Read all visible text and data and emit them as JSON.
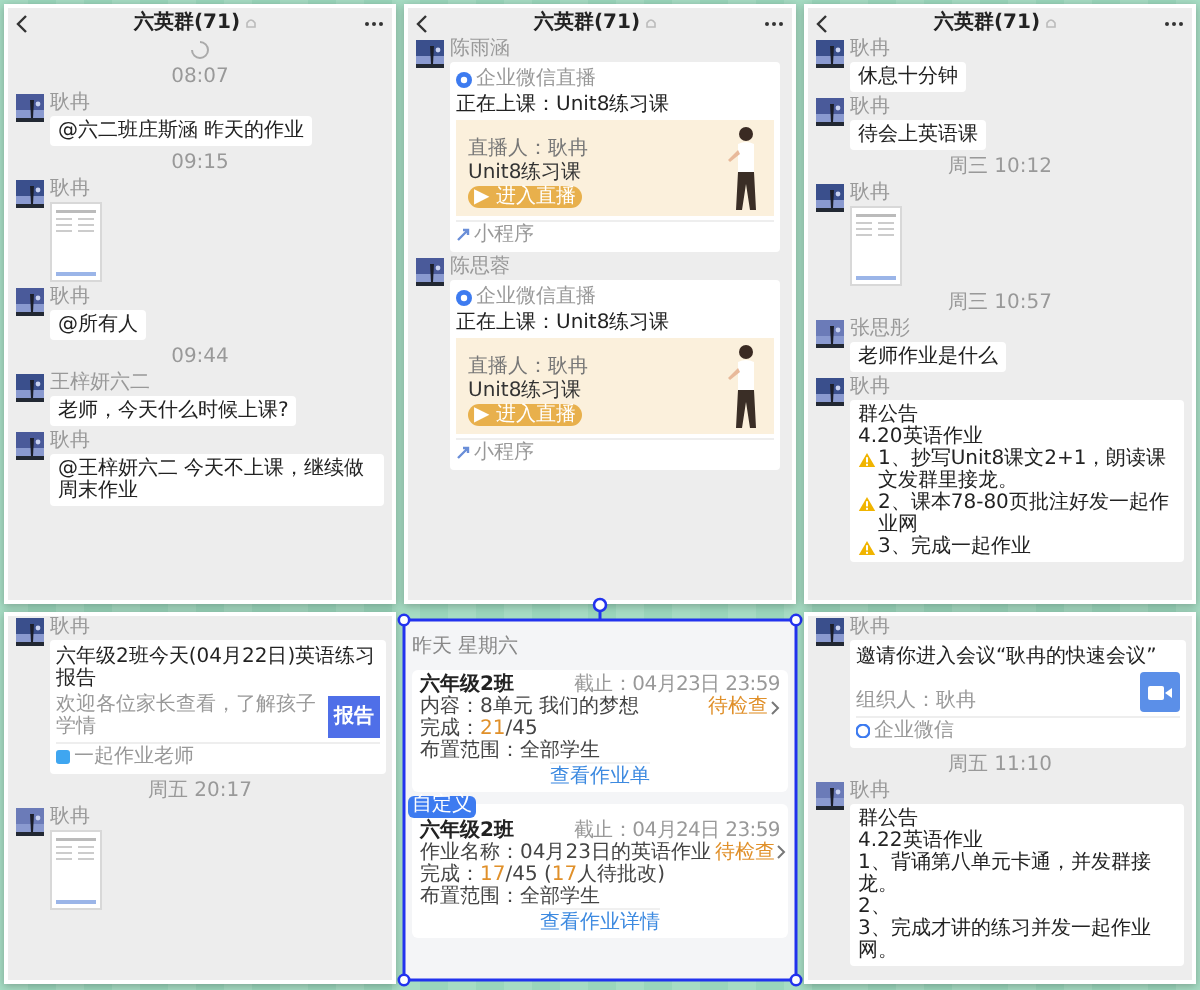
{
  "panels": [
    {
      "kind": "chat",
      "header": {
        "title": "六英群(71)"
      },
      "loading": true,
      "messages": [
        {
          "kind": "time",
          "text": "08:07"
        },
        {
          "kind": "text",
          "sender": "耿冉",
          "text": "@六二班庄斯涵  昨天的作业"
        },
        {
          "kind": "time",
          "text": "09:15"
        },
        {
          "sender": "耿冉"
        },
        {
          "kind": "text",
          "sender": "耿冉",
          "text": "@所有人"
        },
        {
          "kind": "time",
          "text": "09:44"
        },
        {
          "kind": "text",
          "sender": "王梓妍六二",
          "text": "老师，今天什么时候上课?"
        },
        {
          "kind": "text",
          "sender": "耿冉",
          "text": "@王梓妍六二  今天不上课，继续做周末作业"
        }
      ]
    },
    {
      "kind": "chat",
      "header": {
        "title": "六英群(71)"
      },
      "messages": [
        {
          "kind": "live",
          "sender": "陈雨涵",
          "app": "企业微信直播",
          "title": "正在上课：Unit8练习课",
          "host": "直播人：耿冉",
          "course": "Unit8练习课",
          "action": "▶ 进入直播",
          "footer": "小程序"
        },
        {
          "kind": "live",
          "sender": "陈思蓉",
          "app": "企业微信直播",
          "title": "正在上课：Unit8练习课",
          "host": "直播人：耿冉",
          "course": "Unit8练习课",
          "action": "▶ 进入直播",
          "footer": "小程序"
        }
      ]
    },
    {
      "kind": "chat",
      "header": {
        "title": "六英群(71)"
      },
      "messages": [
        {
          "kind": "text",
          "sender": "耿冉",
          "text": "休息十分钟"
        },
        {
          "kind": "text",
          "sender": "耿冉",
          "text": "待会上英语课"
        },
        {
          "kind": "time",
          "text": "周三 10:12"
        },
        {
          "sender": "耿冉"
        },
        {
          "kind": "time",
          "text": "周三 10:57"
        },
        {
          "kind": "text",
          "sender": "张思彤",
          "text": "老师作业是什么"
        },
        {
          "kind": "notice",
          "sender": "耿冉",
          "lines": [
            {
              "text": "群公告",
              "warn": false
            },
            {
              "text": "4.20英语作业",
              "warn": false
            },
            {
              "text": "1、抄写Unit8课文2+1，朗读课文发群里接龙。",
              "warn": true
            },
            {
              "text": "2、课本78-80页批注好发一起作业网",
              "warn": true
            },
            {
              "text": "3、完成一起作业",
              "warn": true
            }
          ]
        }
      ]
    },
    {
      "kind": "chat",
      "messages": [
        {
          "kind": "report",
          "sender": "耿冉",
          "title": "六年级2班今天(04月22日)英语练习报告",
          "desc": "欢迎各位家长查看，了解孩子学情",
          "badge": "报告",
          "footer": "一起作业老师"
        },
        {
          "kind": "time",
          "text": "周五 20:17"
        },
        {
          "sender": "耿冉"
        }
      ]
    },
    {
      "kind": "homework",
      "selected": true,
      "date": "昨天 星期六",
      "items": [
        {
          "class": "六年级2班",
          "deadline": "截止：04月23日 23:59",
          "detail": "内容：8单元 我们的梦想",
          "status": "待检查",
          "done": [
            {
              "text": "完成：",
              "highlight": false
            },
            {
              "text": "21",
              "highlight": true
            },
            {
              "text": "/45",
              "highlight": false
            }
          ],
          "scope": "布置范围：全部学生",
          "link": "查看作业单"
        },
        {
          "tag": "自定义",
          "class": "六年级2班",
          "deadline": "截止：04月24日 23:59",
          "detail": "作业名称：04月23日的英语作业",
          "status": "待检查",
          "done": [
            {
              "text": "完成：",
              "highlight": false
            },
            {
              "text": "17",
              "highlight": true
            },
            {
              "text": "/45 (",
              "highlight": false
            },
            {
              "text": "17",
              "highlight": true
            },
            {
              "text": "人待批改)",
              "highlight": false
            }
          ],
          "scope": "布置范围：全部学生",
          "link": "查看作业详情"
        }
      ]
    },
    {
      "kind": "chat",
      "messages": [
        {
          "kind": "meeting",
          "sender": "耿冉",
          "title": "邀请你进入会议“耿冉的快速会议”",
          "organizer": "组织人：耿冉",
          "footer": "企业微信"
        },
        {
          "kind": "time",
          "text": "周五 11:10"
        },
        {
          "kind": "notice",
          "sender": "耿冉",
          "lines": [
            {
              "text": "群公告",
              "warn": false
            },
            {
              "text": "4.22英语作业",
              "warn": false
            },
            {
              "text": "1、背诵第八单元卡通，并发群接龙。",
              "warn": false
            },
            {
              "text": "2、",
              "warn": false
            },
            {
              "text": "3、完成才讲的练习并发一起作业网。",
              "warn": false
            }
          ]
        }
      ]
    }
  ]
}
